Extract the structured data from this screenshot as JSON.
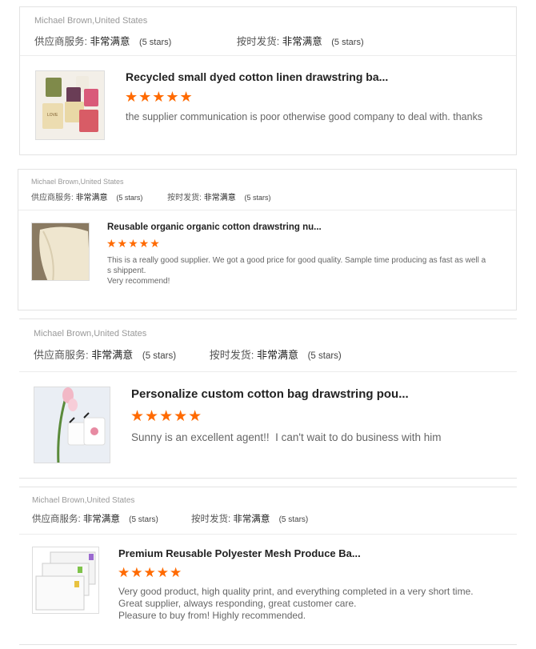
{
  "accent_star_color": "#ff6a00",
  "reviews": [
    {
      "user": "Michael Brown,United States",
      "supplier_label": "供应商服务:",
      "supplier_value": "非常满意",
      "supplier_stars": "(5 stars)",
      "delivery_label": "按时发货:",
      "delivery_value": "非常满意",
      "delivery_stars": "(5 stars)",
      "product_title": "Recycled small dyed cotton linen drawstring ba...",
      "stars": "★★★★★",
      "comment_lines": [
        "the supplier communication is poor otherwise good company to deal with. thanks"
      ]
    },
    {
      "user": "Michael Brown,United States",
      "supplier_label": "供应商服务:",
      "supplier_value": "非常满意",
      "supplier_stars": "(5 stars)",
      "delivery_label": "按时发货:",
      "delivery_value": "非常满意",
      "delivery_stars": "(5 stars)",
      "product_title": "Reusable organic organic cotton drawstring nu...",
      "stars": "★★★★★",
      "comment_lines": [
        "This is a really good supplier. We got a good price for good quality. Sample time producing as fast as well a",
        "s shippent.",
        "Very recommend!"
      ]
    },
    {
      "user": "Michael Brown,United States",
      "supplier_label": "供应商服务:",
      "supplier_value": "非常满意",
      "supplier_stars": "(5 stars)",
      "delivery_label": "按时发货:",
      "delivery_value": "非常满意",
      "delivery_stars": "(5 stars)",
      "product_title": "Personalize custom cotton bag drawstring pou...",
      "stars": "★★★★★",
      "comment_lines": [
        "Sunny is an excellent agent!!  I can't wait to do business with him"
      ]
    },
    {
      "user": "Michael Brown,United States",
      "supplier_label": "供应商服务:",
      "supplier_value": "非常满意",
      "supplier_stars": "(5 stars)",
      "delivery_label": "按时发货:",
      "delivery_value": "非常满意",
      "delivery_stars": "(5 stars)",
      "product_title": "Premium Reusable Polyester Mesh Produce Ba...",
      "stars": "★★★★★",
      "comment_lines": [
        "Very good product, high quality print, and everything completed in a very short time.",
        "Great supplier, always responding, great customer care.",
        "Pleasure to buy from! Highly recommended."
      ]
    }
  ]
}
